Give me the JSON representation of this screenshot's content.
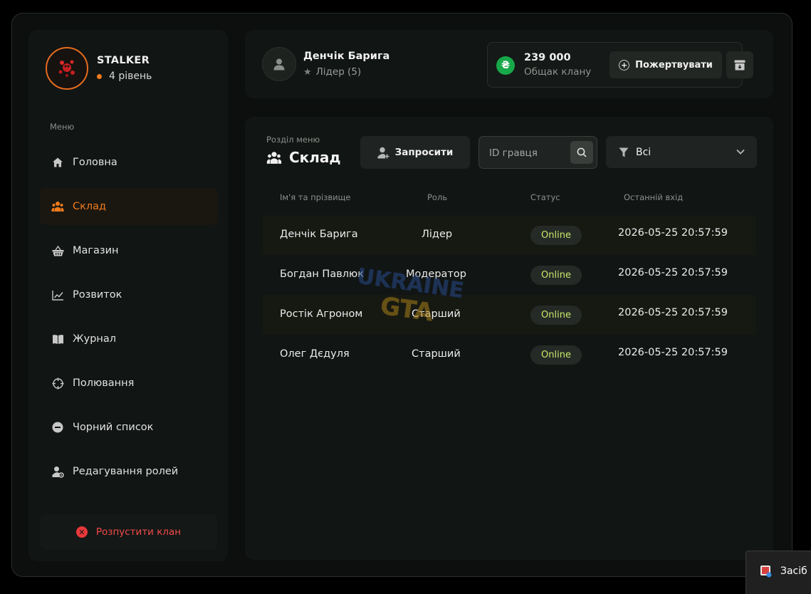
{
  "profile": {
    "name": "STALKER",
    "level": "4 рівень"
  },
  "menu": {
    "caption": "Меню",
    "items": [
      {
        "label": "Головна",
        "icon": "home-icon"
      },
      {
        "label": "Склад",
        "icon": "users-icon",
        "active": true
      },
      {
        "label": "Магазин",
        "icon": "basket-icon"
      },
      {
        "label": "Розвиток",
        "icon": "chart-icon"
      },
      {
        "label": "Журнал",
        "icon": "book-icon"
      },
      {
        "label": "Полювання",
        "icon": "crosshair-icon"
      },
      {
        "label": "Чорний список",
        "icon": "minus-circle-icon"
      },
      {
        "label": "Редагування ролей",
        "icon": "user-gear-icon"
      }
    ],
    "disband_label": "Розпустити клан"
  },
  "leader": {
    "name": "Денчік Барига",
    "role": "Лідер (5)"
  },
  "bank": {
    "currency_symbol": "₴",
    "amount": "239 000",
    "label": "Общак клану",
    "donate_label": "Пожертвувати"
  },
  "section": {
    "caption": "Розділ меню",
    "title": "Склад",
    "invite_label": "Запросити",
    "search_placeholder": "ID гравця",
    "filter_value": "Всі"
  },
  "table": {
    "headers": [
      "Ім'я та прізвище",
      "Роль",
      "Статус",
      "Останній вхід"
    ],
    "rows": [
      {
        "name": "Денчік Барига",
        "role": "Лідер",
        "status": "Online",
        "last_login": "2026-05-25 20:57:59"
      },
      {
        "name": "Богдан Павлюк",
        "role": "Модератор",
        "status": "Online",
        "last_login": "2026-05-25 20:57:59"
      },
      {
        "name": "Ростік Агроном",
        "role": "Старший",
        "status": "Online",
        "last_login": "2026-05-25 20:57:59"
      },
      {
        "name": "Олег Дєдуля",
        "role": "Старший",
        "status": "Online",
        "last_login": "2026-05-25 20:57:59"
      }
    ]
  },
  "watermark": {
    "line1": "UKRAINE",
    "line2": "GTA"
  },
  "taskbar": {
    "label": "Засіб з"
  },
  "colors": {
    "accent": "#f07a1c",
    "online": "#c7e86a",
    "danger": "#f24a4a",
    "coin": "#17a84a"
  }
}
